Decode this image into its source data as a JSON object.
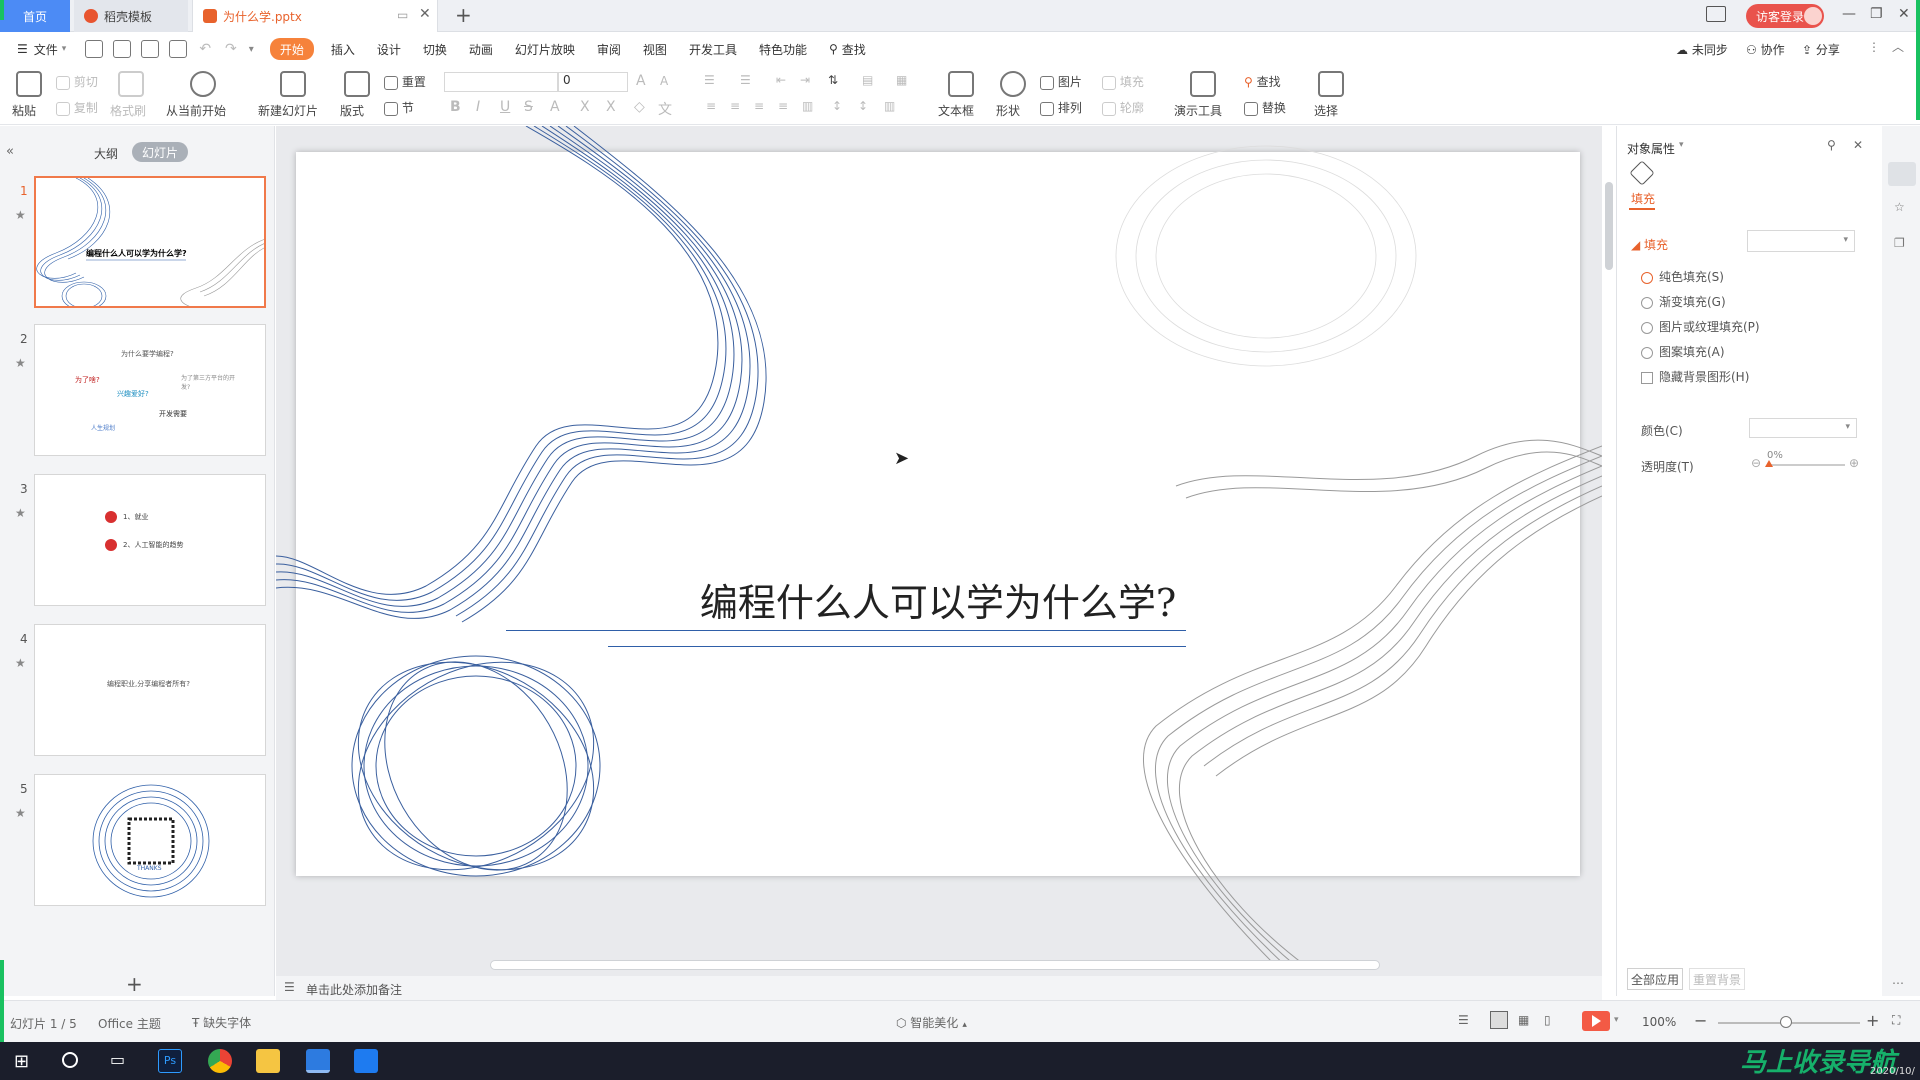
{
  "titlebar": {
    "tab_home": "首页",
    "tab_docer": "稻壳模板",
    "tab_file": "为什么学.pptx",
    "new_tab_icon": "plus-icon",
    "login_label": "访客登录"
  },
  "menubar": {
    "file_label": "文件",
    "items": [
      "开始",
      "插入",
      "设计",
      "切换",
      "动画",
      "幻灯片放映",
      "审阅",
      "视图",
      "开发工具",
      "特色功能"
    ],
    "search_label": "查找",
    "sync_label": "未同步",
    "collab_label": "协作",
    "share_label": "分享"
  },
  "toolbar": {
    "paste": "粘贴",
    "cut": "剪切",
    "copy": "复制",
    "format_painter": "格式刷",
    "from_current": "从当前开始",
    "new_slide": "新建幻灯片",
    "layout": "版式",
    "reset": "重置",
    "section": "节",
    "font_size": "0",
    "textbox": "文本框",
    "shape": "形状",
    "picture": "图片",
    "fill": "填充",
    "arrange": "排列",
    "outline": "轮廓",
    "present_tools": "演示工具",
    "find": "查找",
    "replace": "替换",
    "select": "选择"
  },
  "leftpanel": {
    "outline_tab": "大纲",
    "slides_tab": "幻灯片",
    "slides": [
      {
        "num": "1",
        "title": "编程什么人可以学为什么学?"
      },
      {
        "num": "2",
        "title": "为什么要学编程?",
        "items": [
          "为了啥?",
          "兴趣爱好?",
          "开发需要",
          "为了第三方平台的开发?",
          "人生规划"
        ]
      },
      {
        "num": "3",
        "items": [
          "1、就业",
          "2、人工智能的趋势"
        ]
      },
      {
        "num": "4",
        "title": "编程职业,分享编程者所有?"
      },
      {
        "num": "5",
        "caption": "THANKS"
      }
    ],
    "add_slide_icon": "plus-icon"
  },
  "slide": {
    "title": "编程什么人可以学为什么学?"
  },
  "notes": {
    "placeholder": "单击此处添加备注"
  },
  "rightpanel": {
    "title": "对象属性",
    "tab_fill": "填充",
    "section_fill": "填充",
    "options": [
      "纯色填充(S)",
      "渐变填充(G)",
      "图片或纹理填充(P)",
      "图案填充(A)"
    ],
    "hide_bg": "隐藏背景图形(H)",
    "color_label": "颜色(C)",
    "transparency_label": "透明度(T)",
    "transparency_value": "0%",
    "apply_all": "全部应用",
    "reset_bg": "重置背景"
  },
  "statusbar": {
    "slide_info": "幻灯片 1 / 5",
    "theme": "Office 主题",
    "missing_font": "缺失字体",
    "smart_beautify": "智能美化",
    "zoom": "100%"
  },
  "taskbar": {
    "clock_date": "2020/10/",
    "watermark": "马上收录导航"
  }
}
